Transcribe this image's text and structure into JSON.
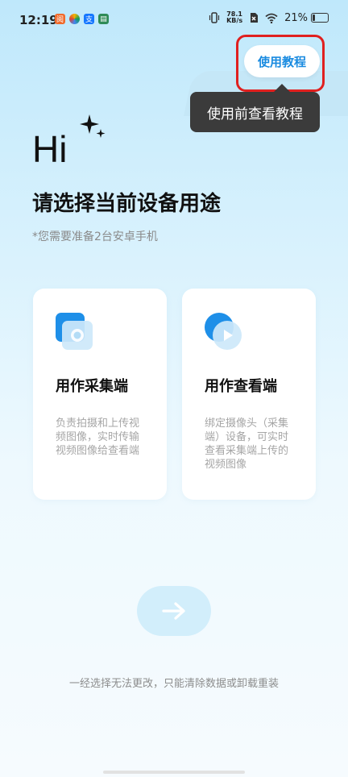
{
  "status_bar": {
    "time": "12:19",
    "net_speed_value": "78.1",
    "net_speed_unit": "KB/s",
    "battery_percent": "21%",
    "battery_level": 0.21,
    "app_icons": [
      "news-app-icon",
      "colorful-app-icon",
      "alipay-icon",
      "wallet-icon"
    ]
  },
  "header": {
    "tutorial_button_label": "使用教程",
    "tooltip_text": "使用前查看教程"
  },
  "hero": {
    "greeting": "Hi",
    "title": "请选择当前设备用途",
    "subtitle": "*您需要准备2台安卓手机"
  },
  "cards": [
    {
      "title": "用作采集端",
      "description": "负责拍摄和上传视频图像，实时传输视频图像给查看端",
      "icon": "capture-icon"
    },
    {
      "title": "用作查看端",
      "description": "绑定摄像头（采集端）设备，可实时查看采集端上传的视频图像",
      "icon": "viewer-icon"
    }
  ],
  "footer": {
    "note": "一经选择无法更改，只能清除数据或卸载重装"
  },
  "colors": {
    "accent": "#1a8be0",
    "highlight": "#e0201f",
    "tooltip_bg": "#3b3b3b",
    "next_button_bg": "#d2eefb"
  }
}
